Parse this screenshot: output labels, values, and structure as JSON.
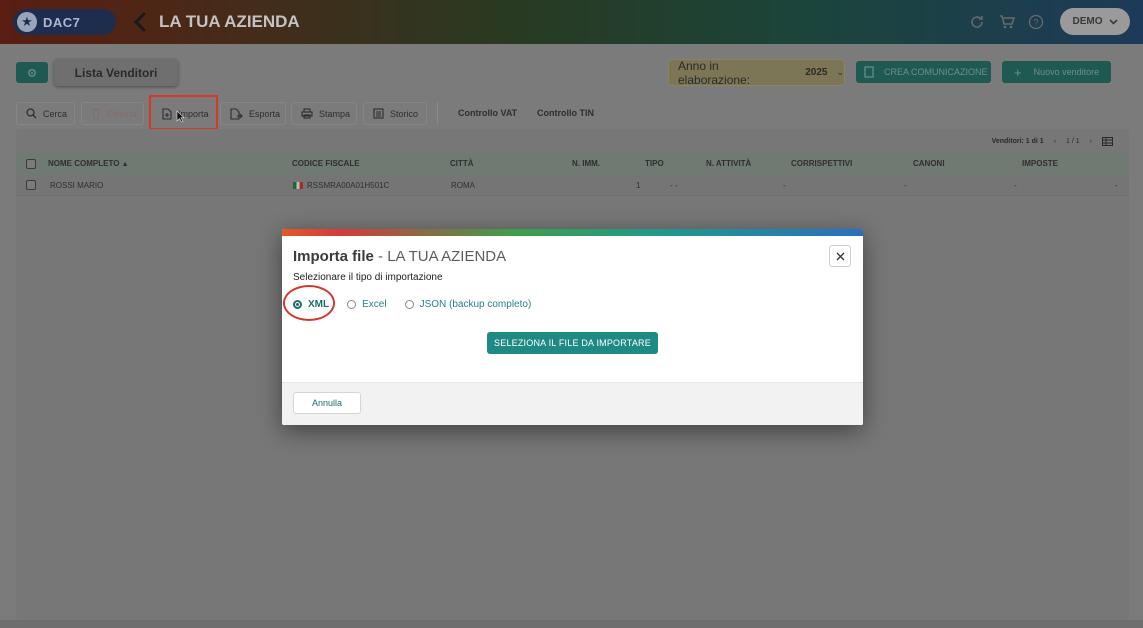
{
  "header": {
    "logo_text": "DAC7",
    "company": "LA TUA AZIENDA",
    "user_label": "DEMO"
  },
  "toolbar": {
    "lista_label": "Lista Venditori",
    "anno_label": "Anno in elaborazione:",
    "anno_value": "2025",
    "crea_label": "CREA COMUNICAZIONE",
    "nuovo_label": "Nuovo venditore",
    "buttons": {
      "cerca": "Cerca",
      "elimina": "Elimina",
      "importa": "Importa",
      "esporta": "Esporta",
      "stampa": "Stampa",
      "storico": "Storico"
    },
    "controllo_vat": "Controllo VAT",
    "controllo_tin": "Controllo TIN"
  },
  "table": {
    "count_label": "Venditori: 1 di 1",
    "page_label": "1 / 1",
    "columns": {
      "nome": "NOME COMPLETO",
      "codice": "CODICE FISCALE",
      "citta": "CITTÀ",
      "nimm": "N. IMM.",
      "tipo": "TIPO",
      "natt": "N. ATTIVITÀ",
      "corr": "CORRISPETTIVI",
      "canoni": "CANONI",
      "imposte": "IMPOSTE"
    },
    "rows": [
      {
        "nome": "ROSSI MARIO",
        "codice": "RSSMRA00A01H501C",
        "citta": "ROMA",
        "nimm": "1",
        "tipo": "- -",
        "natt": "",
        "corr": "-",
        "canoni": "-",
        "imposte": "-",
        "extra": "-"
      }
    ]
  },
  "modal": {
    "title_main": "Importa file",
    "title_sep": " - ",
    "title_company": "LA TUA AZIENDA",
    "instruction": "Selezionare il tipo di importazione",
    "options": {
      "xml": "XML",
      "excel": "Excel",
      "json": "JSON (backup completo)"
    },
    "selected": "XML",
    "select_file_button": "SELEZIONA IL FILE DA IMPORTARE",
    "cancel_button": "Annulla"
  },
  "colors": {
    "teal": "#1f8a84",
    "highlight_red": "#d7362a"
  }
}
